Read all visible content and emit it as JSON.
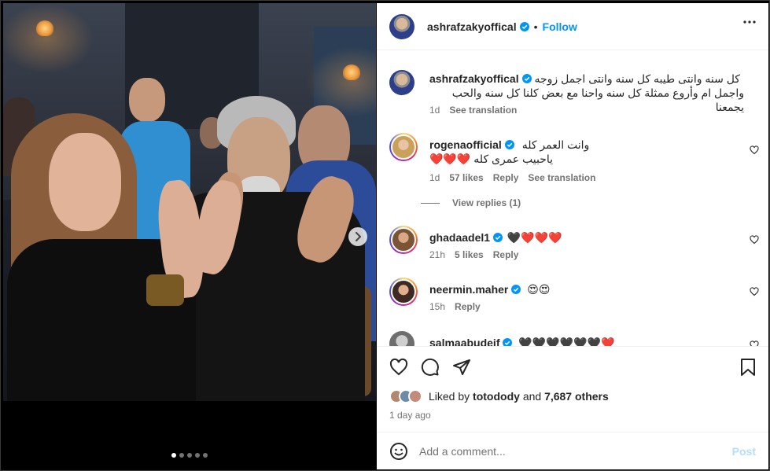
{
  "owner": {
    "username": "ashrafzakyoffical",
    "follow_label": "Follow",
    "separator": "•"
  },
  "caption": {
    "username": "ashrafzakyoffical",
    "line1": "كل سنه وانتى طيبه كل سنه وانتى اجمل زوجه",
    "line2": "واجمل ام وأروع ممثلة كل سنه واحنا مع بعض كلنا كل سنه والحب يجمعنا",
    "age": "1d",
    "see_translation": "See translation"
  },
  "comments": [
    {
      "username": "rogenaofficial",
      "text1": "وانت العمر كله",
      "text2": "ياحبيب عمرى كله",
      "emojis": "❤️❤️❤️",
      "age": "1d",
      "likes": "57 likes",
      "reply": "Reply",
      "see_translation": "See translation"
    },
    {
      "username": "ghadaadel1",
      "emojis": "🖤❤️❤️❤️",
      "age": "21h",
      "likes": "5 likes",
      "reply": "Reply"
    },
    {
      "username": "neermin.maher",
      "emojis": "😍😍",
      "age": "15h",
      "reply": "Reply"
    },
    {
      "username": "salmaabudeif",
      "emojis": "🖤🖤🖤🖤🖤🖤❤️"
    }
  ],
  "view_replies": "View replies (1)",
  "likes": {
    "prefix": "Liked by",
    "user": "totodody",
    "and": "and",
    "others": "7,687 others"
  },
  "posted": "1 day ago",
  "add_comment": {
    "placeholder": "Add a comment...",
    "post_label": "Post"
  },
  "carousel": {
    "slides": 5,
    "active": 1
  },
  "colors": {
    "accent": "#0095f6",
    "heart": "#ed4956",
    "muted": "#737373"
  }
}
